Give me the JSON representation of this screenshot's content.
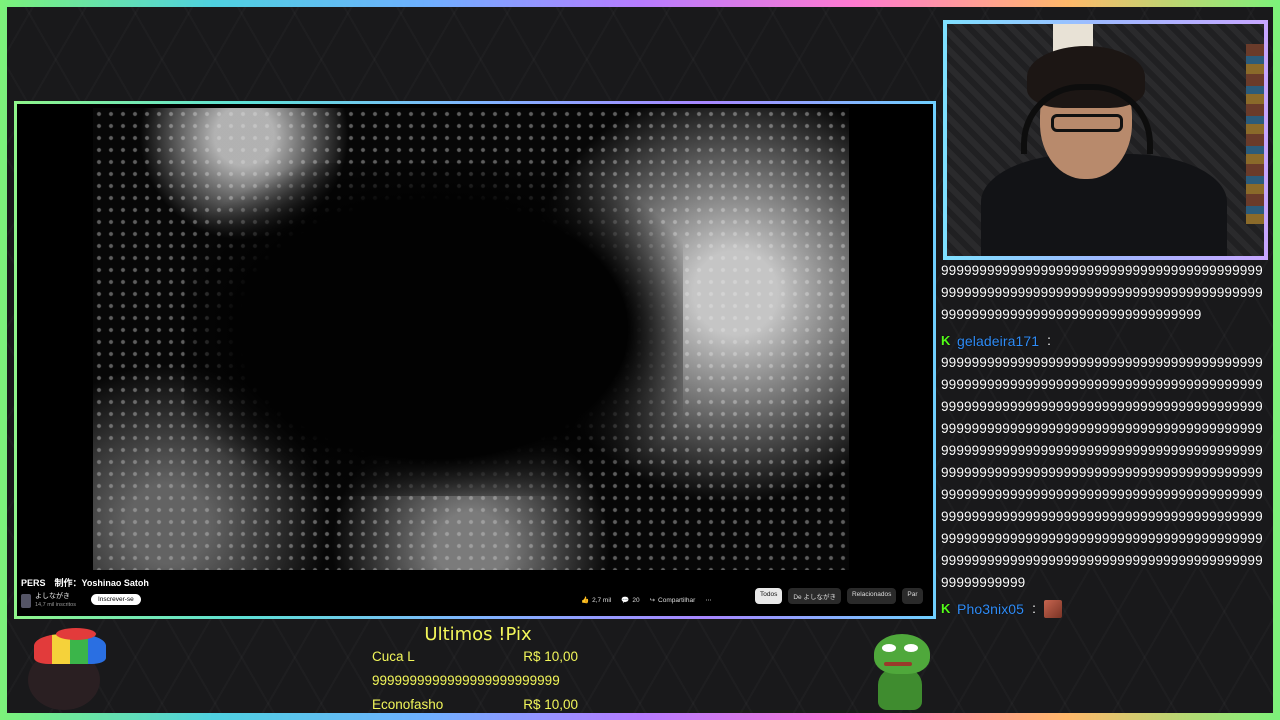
{
  "video": {
    "title": "PERS　制作：Yoshinao Satoh",
    "channel_name": "よしながき",
    "subscribers": "14,7 mil inscritos",
    "subscribe_label": "Inscrever-se",
    "likes": "2,7 mil",
    "comments": "20",
    "share_label": "Compartilhar",
    "more_label": "⋯",
    "chips": [
      "Todos",
      "De よしながき",
      "Relacionados",
      "Par"
    ]
  },
  "chat": {
    "messages": [
      {
        "user": "",
        "text": "9999999999999999999999999999999999999999999999999999999999999999999999999999999999999999999999999999999999999999999999"
      },
      {
        "user": "geladeira171",
        "text": "99999999999999999999999999999999999999999999999999999999999999999999999999999999999999999999999999999999999999999999999999999999999999999999999999999999999999999999999999999999999999999999999999999999999999999999999999999999999999999999999999999999999999999999999999999999999999999999999999999999999999999999999999999999999999999999999999999999999999999999999999999999999999999999999999999999999999999999999999999999999999999999999"
      },
      {
        "user": "Pho3nix05",
        "text": ""
      }
    ]
  },
  "pix": {
    "title": "Ultimos !Pix",
    "rows": [
      {
        "name": "Cuca L",
        "amount": "R$ 10,00"
      },
      {
        "name": "9999999999999999999999999",
        "amount": ""
      },
      {
        "name": "Econofasho",
        "amount": "R$ 10,00"
      }
    ]
  },
  "colors": {
    "accent_yellow": "#f2f65a",
    "username_blue": "#2f8cf7",
    "badge_green": "#53fc18"
  }
}
